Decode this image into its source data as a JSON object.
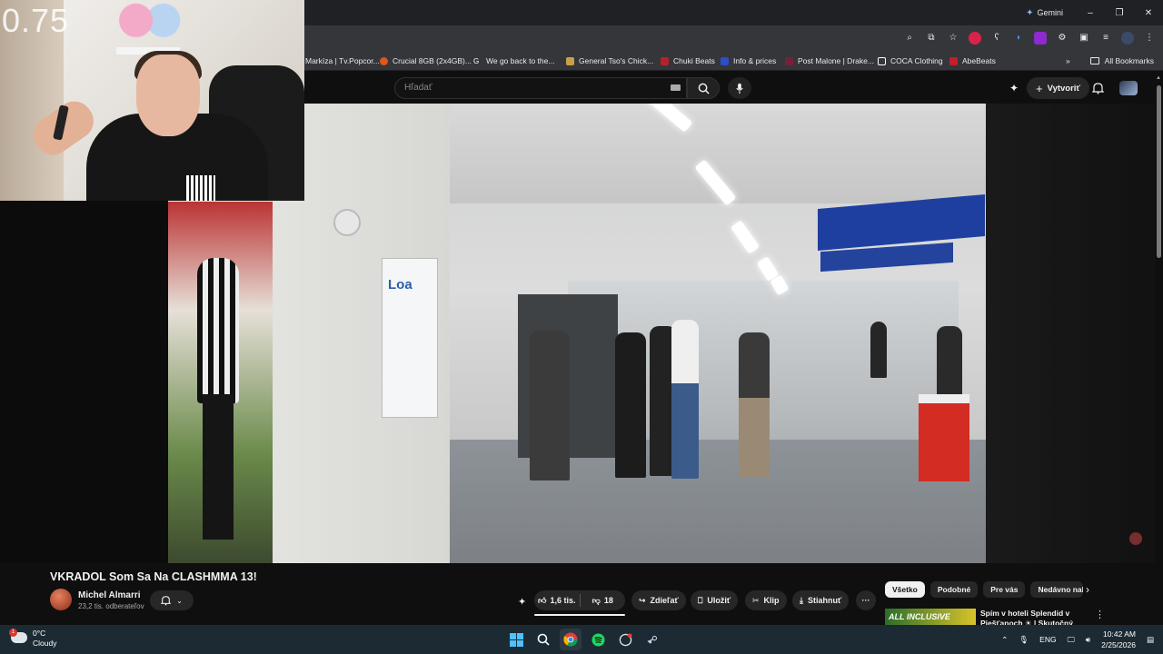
{
  "browser": {
    "gemini_label": "Gemini",
    "window_controls": [
      "–",
      "❐",
      "✕"
    ],
    "bookmarks": [
      {
        "label": "Markíza | Tv.Popcor...",
        "color": "#7a4a2a"
      },
      {
        "label": "Crucial 8GB (2x4GB)...",
        "color": "#e2551b"
      },
      {
        "label": "We go back to the...",
        "color": "#ffffff"
      },
      {
        "label": "General Tso's Chick...",
        "color": "#c9a04a"
      },
      {
        "label": "Chuki Beats",
        "color": "#b5232a"
      },
      {
        "label": "Info & prices",
        "color": "#2b4fc7"
      },
      {
        "label": "Post Malone | Drake...",
        "color": "#7a1f3a"
      },
      {
        "label": "COCA Clothing",
        "color": "#ffffff"
      },
      {
        "label": "AbeBeats",
        "color": "#c51d2b"
      }
    ],
    "more_bookmarks": "»",
    "all_bookmarks": "All Bookmarks"
  },
  "youtube": {
    "search_placeholder": "Hľadať",
    "create_label": "Vytvoriť",
    "video_title": "VKRADOL Som Sa Na CLASHMMA 13!",
    "channel_name": "Michel Almarri",
    "subscribers": "23,2 tis. odberateľov",
    "likes": "1,6 tis.",
    "dislikes": "18",
    "share_label": "Zdieľať",
    "save_label": "Uložiť",
    "clip_label": "Klip",
    "download_label": "Stiahnuť",
    "more_label": "···",
    "chips": [
      "Všetko",
      "Podobné",
      "Pre vás",
      "Nedávno nahr..."
    ],
    "rec_thumb_text": "ALL INCLUSIVE",
    "rec_title": "Spím v hoteli Splendid v Piešťanoch ☀ | Skutočný All..."
  },
  "webcam": {
    "overlay_number": "0.75"
  },
  "taskbar": {
    "weather_temp": "0°C",
    "weather_desc": "Cloudy",
    "weather_badge": "1",
    "language": "ENG",
    "time": "10:42 AM",
    "date": "2/25/2026"
  }
}
